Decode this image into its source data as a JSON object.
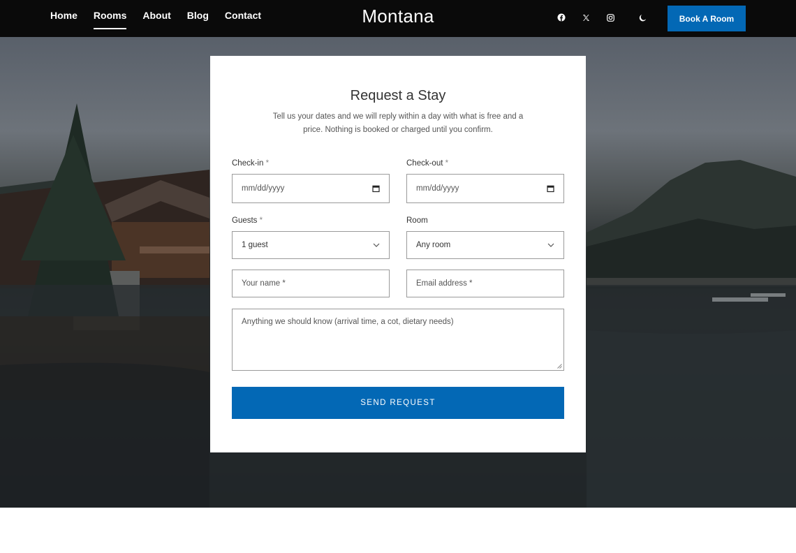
{
  "nav": {
    "items": [
      {
        "label": "Home",
        "active": false
      },
      {
        "label": "Rooms",
        "active": true
      },
      {
        "label": "About",
        "active": false
      },
      {
        "label": "Blog",
        "active": false
      },
      {
        "label": "Contact",
        "active": false
      }
    ]
  },
  "brand": {
    "name": "Montana"
  },
  "social": {
    "icons": [
      "facebook-icon",
      "x-icon",
      "instagram-icon"
    ],
    "theme_toggle_icon": "moon-icon"
  },
  "header": {
    "cta_label": "Book A Room"
  },
  "colors": {
    "accent": "#0368b5",
    "topbar": "#0a0a0a"
  },
  "form": {
    "title": "Request a Stay",
    "intro": "Tell us your dates and we will reply within a day with what is free and a price. Nothing is booked or charged until you confirm.",
    "checkin": {
      "label": "Check-in",
      "required_mark": "*",
      "placeholder": "mm/dd/yyyy"
    },
    "checkout": {
      "label": "Check-out",
      "required_mark": "*",
      "placeholder": "mm/dd/yyyy"
    },
    "guests": {
      "label": "Guests",
      "required_mark": "*",
      "value": "1 guest"
    },
    "room": {
      "label": "Room",
      "value": "Any room"
    },
    "name": {
      "placeholder": "Your name *"
    },
    "email": {
      "placeholder": "Email address *"
    },
    "notes": {
      "placeholder": "Anything we should know (arrival time, a cot, dietary needs)"
    },
    "submit_label": "SEND REQUEST"
  }
}
